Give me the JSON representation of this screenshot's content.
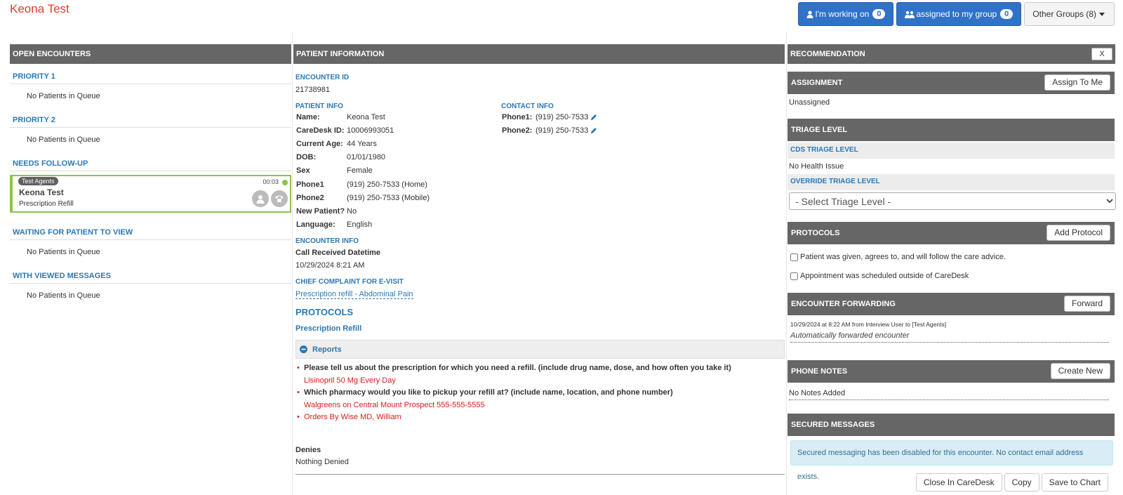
{
  "app": {
    "title": "Keona Test"
  },
  "top_buttons": {
    "working_on": {
      "label": "I'm working on",
      "count": "0"
    },
    "assigned_group": {
      "label": "assigned to my group",
      "count": "0"
    },
    "other_groups": {
      "label": "Other Groups (8)"
    }
  },
  "left": {
    "header": "OPEN ENCOUNTERS",
    "queues": [
      {
        "title": "PRIORITY 1",
        "empty": "No Patients in Queue"
      },
      {
        "title": "PRIORITY 2",
        "empty": "No Patients in Queue"
      },
      {
        "title": "NEEDS FOLLOW-UP"
      },
      {
        "title": "WAITING FOR PATIENT TO VIEW",
        "empty": "No Patients in Queue"
      },
      {
        "title": "WITH VIEWED MESSAGES",
        "empty": "No Patients in Queue"
      }
    ],
    "card": {
      "tag": "Test Agents",
      "name": "Keona Test",
      "sub": "Prescription Refill",
      "time": "00:03"
    }
  },
  "middle": {
    "header": "PATIENT INFORMATION",
    "encounter_id_label": "ENCOUNTER ID",
    "encounter_id": "21738981",
    "patient_info_label": "PATIENT INFO",
    "patient_info": [
      {
        "k": "Name:",
        "v": "Keona Test"
      },
      {
        "k": "CareDesk ID:",
        "v": "10006993051"
      },
      {
        "k": "Current Age:",
        "v": "44 Years"
      },
      {
        "k": "DOB:",
        "v": "01/01/1980"
      },
      {
        "k": "Sex",
        "v": "Female"
      },
      {
        "k": "Phone1",
        "v": "(919) 250-7533 (Home)"
      },
      {
        "k": "Phone2",
        "v": "(919) 250-7533 (Mobile)"
      },
      {
        "k": "New Patient?",
        "v": "No"
      },
      {
        "k": "Language:",
        "v": "English"
      }
    ],
    "contact_info_label": "CONTACT INFO",
    "contact_info": [
      {
        "k": "Phone1:",
        "v": "(919) 250-7533"
      },
      {
        "k": "Phone2:",
        "v": "(919) 250-7533"
      }
    ],
    "encounter_info_label": "ENCOUNTER INFO",
    "call_received_label": "Call Received Datetime",
    "call_received_value": "10/29/2024 8:21 AM",
    "chief_complaint_label": "CHIEF COMPLAINT FOR E-VISIT",
    "chief_complaint_value": "Prescription refill - Abdominal Pain",
    "protocols_label": "PROTOCOLS",
    "protocol_name": "Prescription Refill",
    "reports_label": "Reports",
    "report_items": [
      {
        "q": "Please tell us about the prescription for which you need a refill. (include drug name, dose, and how often you take it)",
        "a": "Lisinopril 50 Mg Every Day"
      },
      {
        "q": "Which pharmacy would you like to pickup your refill at? (include name, location, and phone number)",
        "a": "Walgreens on Central Mount Prospect 555-555-5555"
      }
    ],
    "orders_by": "Orders By Wise MD, William",
    "denies_label": "Denies",
    "denies_value": "Nothing Denied"
  },
  "right": {
    "header": "RECOMMENDATION",
    "close_label": "X",
    "assignment": {
      "label": "ASSIGNMENT",
      "button": "Assign To Me",
      "value": "Unassigned"
    },
    "triage": {
      "label": "TRIAGE LEVEL",
      "cds_label": "CDS TRIAGE LEVEL",
      "cds_value": "No Health Issue",
      "override_label": "OVERRIDE TRIAGE LEVEL",
      "select_value": "- Select Triage Level -"
    },
    "protocols": {
      "label": "PROTOCOLS",
      "button": "Add Protocol",
      "checks": [
        "Patient was given, agrees to, and will follow the care advice.",
        "Appointment was scheduled outside of CareDesk"
      ]
    },
    "forwarding": {
      "label": "ENCOUNTER FORWARDING",
      "button": "Forward",
      "log": "10/29/2024 at 8:22 AM from Interview User to [Test Agents]",
      "note": "Automatically forwarded encounter"
    },
    "phone_notes": {
      "label": "PHONE NOTES",
      "button": "Create New",
      "value": "No Notes Added"
    },
    "secured": {
      "label": "SECURED MESSAGES",
      "info": "Secured messaging has been disabled for this encounter. No contact email address exists."
    },
    "bottom_buttons": {
      "close": "Close In CareDesk",
      "copy": "Copy",
      "save": "Save to Chart"
    }
  },
  "colors": {
    "accent_blue": "#2a78b5",
    "title_red": "#e03c2e",
    "answer_red": "#d81c1c",
    "header_gray": "#666666",
    "card_green": "#8bc34a"
  }
}
